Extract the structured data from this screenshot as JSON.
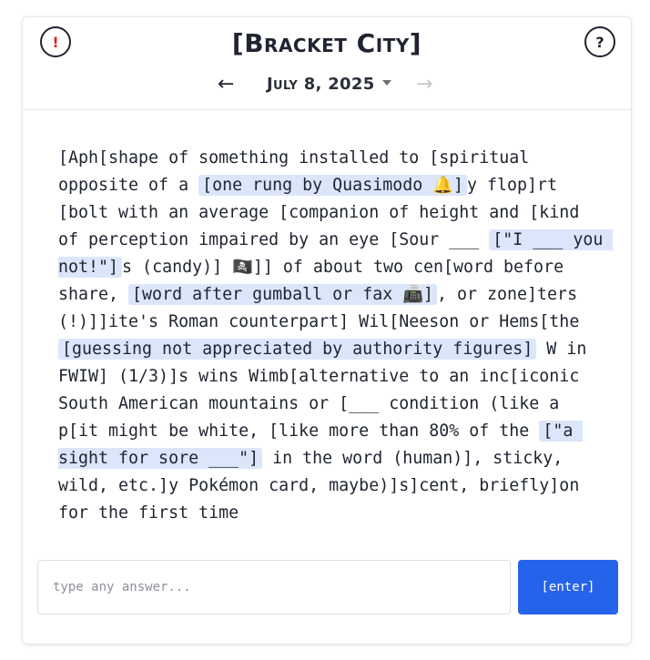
{
  "header": {
    "alert_icon": "!",
    "help_icon": "?",
    "title": "[Bracket City]",
    "date": "July 8, 2025",
    "prev_icon": "←",
    "next_icon": "→"
  },
  "puzzle": {
    "segments": [
      {
        "t": "[Aph[shape of something installed to [spiritual opposite of a "
      },
      {
        "t": "[one rung by Quasimodo 🔔]",
        "c": true
      },
      {
        "t": "y flop]rt [bolt with an average [companion of height and [kind of perception impaired by an eye [Sour ___ "
      },
      {
        "t": "[\"I ___ you not!\"]",
        "c": true
      },
      {
        "t": "s (candy)] 🏴‍☠️]] of about two cen[word before share, "
      },
      {
        "t": "[word after gumball or fax 📠]",
        "c": true
      },
      {
        "t": ", or zone]ters (!)]]ite's Roman counterpart] Wil[Neeson or Hems[the "
      },
      {
        "t": "[guessing not appreciated by authority figures]",
        "c": true
      },
      {
        "t": " W in FWIW] (1/3)]s wins Wimb[alternative to an inc[iconic South American mountains or [___ condition (like a p[it might be white, [like more than 80% of the "
      },
      {
        "t": "[\"a sight for sore ___\"]",
        "c": true
      },
      {
        "t": " in the word (human)], sticky, wild, etc.]y Pokémon card, maybe)]s]cent, briefly]on for the first time"
      }
    ]
  },
  "input": {
    "placeholder": "type any answer...",
    "value": ""
  },
  "enter_label": "[enter]",
  "colors": {
    "accent": "#2563eb",
    "clue_highlight": "#dbe6fb",
    "alert": "#d9262b"
  }
}
